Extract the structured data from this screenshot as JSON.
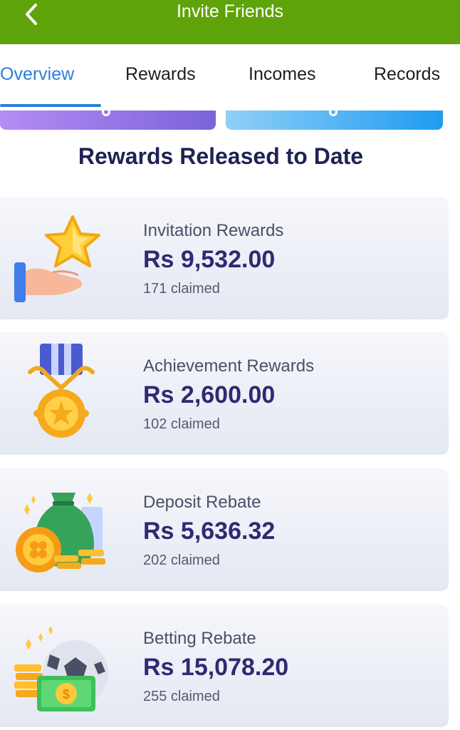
{
  "header": {
    "title": "Invite Friends",
    "back_icon": "chevron-left-icon",
    "background": "#5fa30a"
  },
  "tabs": [
    {
      "label": "Overview",
      "active": true
    },
    {
      "label": "Rewards",
      "active": false
    },
    {
      "label": "Incomes",
      "active": false
    },
    {
      "label": "Records",
      "active": false
    }
  ],
  "accent_color": "#2b7fd9",
  "section": {
    "title": "Rewards Released to Date"
  },
  "cards": [
    {
      "title": "Invitation Rewards",
      "amount": "Rs 9,532.00",
      "claimed": "171 claimed",
      "icon": "hand-star-icon"
    },
    {
      "title": "Achievement Rewards",
      "amount": "Rs 2,600.00",
      "claimed": "102 claimed",
      "icon": "medal-icon"
    },
    {
      "title": "Deposit Rebate",
      "amount": "Rs 5,636.32",
      "claimed": "202 claimed",
      "icon": "money-bag-icon"
    },
    {
      "title": "Betting Rebate",
      "amount": "Rs 15,078.20",
      "claimed": "255 claimed",
      "icon": "soccer-ball-cash-icon"
    }
  ]
}
